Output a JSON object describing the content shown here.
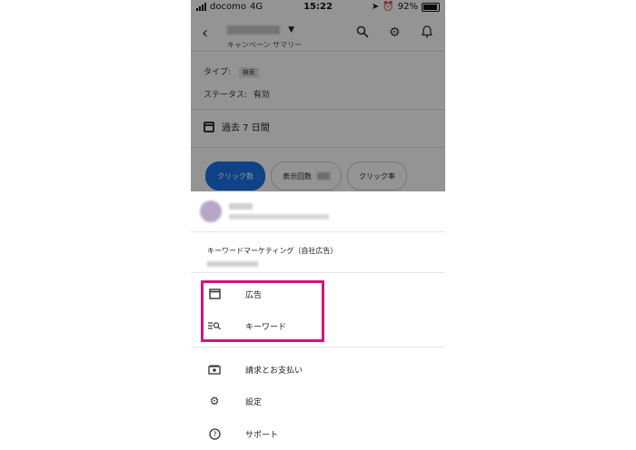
{
  "status_bar": {
    "carrier": "docomo",
    "network": "4G",
    "time": "15:22",
    "battery": "92%"
  },
  "header": {
    "subtitle": "キャンペーン サマリー",
    "caret": "▼"
  },
  "campaign": {
    "type_label": "タイプ:",
    "type_value": "検索",
    "status_label": "ステータス:",
    "status_value": "有効",
    "date_range": "過去 7 日間"
  },
  "metrics": [
    {
      "label": "クリック数"
    },
    {
      "label": "表示回数"
    },
    {
      "label": "クリック率"
    }
  ],
  "sheet": {
    "manager_name": "キーワードマーケティング（自社広告）",
    "menu_highlighted": [
      {
        "label": "広告",
        "icon": "web-page-icon"
      },
      {
        "label": "キーワード",
        "icon": "keyword-search-icon"
      }
    ],
    "menu_other": [
      {
        "label": "請求とお支払い",
        "icon": "billing-icon"
      },
      {
        "label": "設定",
        "icon": "settings-gear-icon"
      },
      {
        "label": "サポート",
        "icon": "help-icon"
      }
    ]
  },
  "colors": {
    "accent": "#1a73e8",
    "highlight": "#d4147a"
  }
}
